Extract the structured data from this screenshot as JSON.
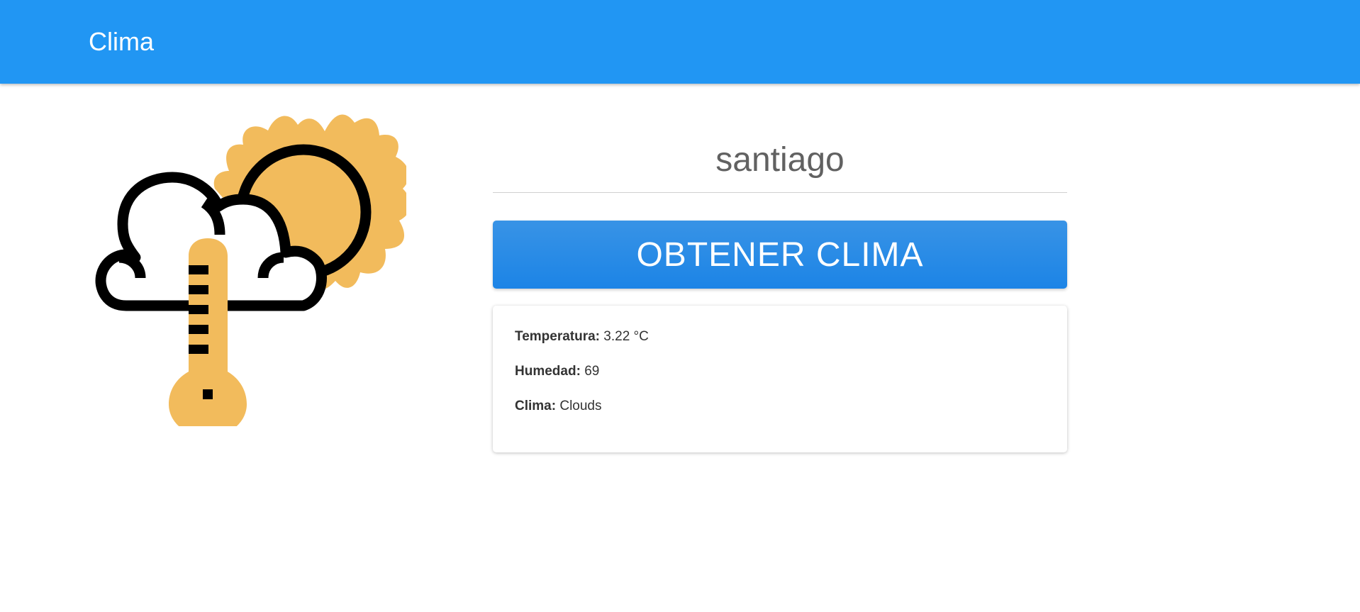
{
  "navbar": {
    "brand": "Clima",
    "color": "#2196f3"
  },
  "illustration": {
    "icon": "weather-cloud-sun-thermometer-icon",
    "sun_color": "#f2bb5c",
    "outline_color": "#000000"
  },
  "form": {
    "city_value": "santiago",
    "button_label": "OBTENER CLIMA"
  },
  "result": {
    "temperature_label": "Temperatura:",
    "temperature_value": "3.22 °C",
    "humidity_label": "Humedad:",
    "humidity_value": "69",
    "weather_label": "Clima:",
    "weather_value": "Clouds"
  }
}
